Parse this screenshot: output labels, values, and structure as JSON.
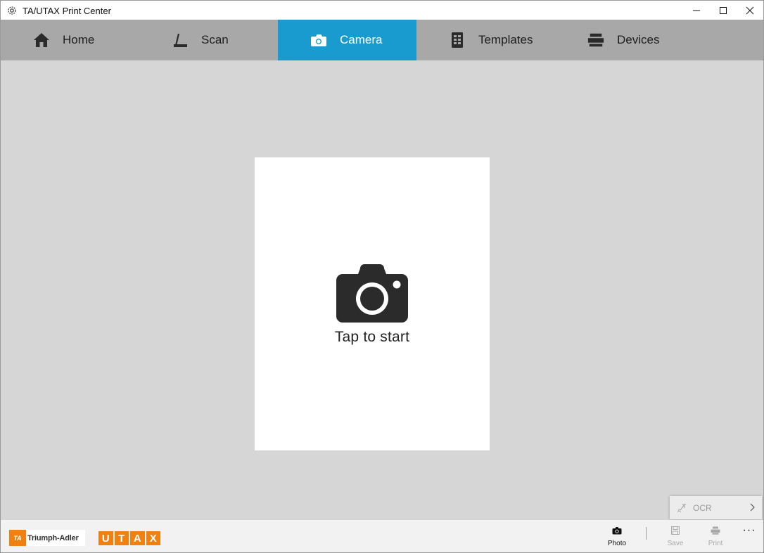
{
  "window": {
    "title": "TA/UTAX Print Center",
    "controls": {
      "minimize": "minimize-icon",
      "maximize": "maximize-icon",
      "close": "close-icon"
    }
  },
  "nav": {
    "items": [
      {
        "label": "Home",
        "icon": "home-icon",
        "active": false
      },
      {
        "label": "Scan",
        "icon": "scan-icon",
        "active": false
      },
      {
        "label": "Camera",
        "icon": "camera-icon",
        "active": true
      },
      {
        "label": "Templates",
        "icon": "templates-icon",
        "active": false
      },
      {
        "label": "Devices",
        "icon": "devices-icon",
        "active": false
      }
    ],
    "accent": "#1a9bd0"
  },
  "main": {
    "tap_label": "Tap to start"
  },
  "ocr": {
    "label": "OCR"
  },
  "bottombar": {
    "logos": {
      "ta": "Triumph-Adler",
      "ta_mark": "TA",
      "utax": [
        "U",
        "T",
        "A",
        "X"
      ]
    },
    "commands": [
      {
        "label": "Photo",
        "icon": "camera-icon",
        "enabled": true
      },
      {
        "label": "Save",
        "icon": "save-icon",
        "enabled": false
      },
      {
        "label": "Print",
        "icon": "print-icon",
        "enabled": false
      }
    ],
    "more": "···"
  }
}
